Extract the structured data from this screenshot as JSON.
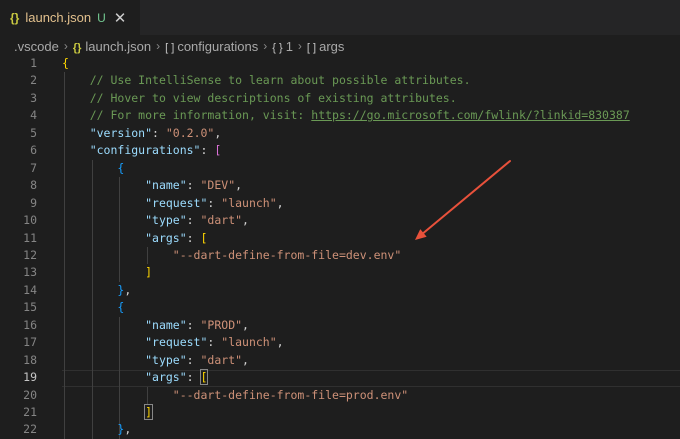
{
  "tab": {
    "icon": "json-braces-icon",
    "icon_glyph": "{}",
    "filename": "launch.json",
    "status": "U",
    "close_glyph": "✕"
  },
  "breadcrumb": {
    "items": [
      {
        "icon": "",
        "label": ".vscode"
      },
      {
        "icon": "{}",
        "label": "launch.json"
      },
      {
        "icon": "[ ]",
        "label": "configurations"
      },
      {
        "icon": "{ }",
        "label": "1"
      },
      {
        "icon": "[ ]",
        "label": "args"
      }
    ],
    "separator": "›"
  },
  "editor": {
    "active_line": 19,
    "lines": [
      {
        "n": "1",
        "tokens": [
          [
            "b1",
            "{"
          ]
        ]
      },
      {
        "n": "2",
        "tokens": [
          [
            "ws",
            "    "
          ],
          [
            "comment",
            "// Use IntelliSense to learn about possible attributes."
          ]
        ]
      },
      {
        "n": "3",
        "tokens": [
          [
            "ws",
            "    "
          ],
          [
            "comment",
            "// Hover to view descriptions of existing attributes."
          ]
        ]
      },
      {
        "n": "4",
        "tokens": [
          [
            "ws",
            "    "
          ],
          [
            "comment",
            "// For more information, visit: "
          ],
          [
            "link",
            "https://go.microsoft.com/fwlink/?linkid=830387"
          ]
        ]
      },
      {
        "n": "5",
        "tokens": [
          [
            "ws",
            "    "
          ],
          [
            "key",
            "\"version\""
          ],
          [
            "punct",
            ": "
          ],
          [
            "str",
            "\"0.2.0\""
          ],
          [
            "punct",
            ","
          ]
        ]
      },
      {
        "n": "6",
        "tokens": [
          [
            "ws",
            "    "
          ],
          [
            "key",
            "\"configurations\""
          ],
          [
            "punct",
            ": "
          ],
          [
            "b2",
            "["
          ]
        ]
      },
      {
        "n": "7",
        "tokens": [
          [
            "ws",
            "        "
          ],
          [
            "b3",
            "{"
          ]
        ]
      },
      {
        "n": "8",
        "tokens": [
          [
            "ws",
            "            "
          ],
          [
            "key",
            "\"name\""
          ],
          [
            "punct",
            ": "
          ],
          [
            "str",
            "\"DEV\""
          ],
          [
            "punct",
            ","
          ]
        ]
      },
      {
        "n": "9",
        "tokens": [
          [
            "ws",
            "            "
          ],
          [
            "key",
            "\"request\""
          ],
          [
            "punct",
            ": "
          ],
          [
            "str",
            "\"launch\""
          ],
          [
            "punct",
            ","
          ]
        ]
      },
      {
        "n": "10",
        "tokens": [
          [
            "ws",
            "            "
          ],
          [
            "key",
            "\"type\""
          ],
          [
            "punct",
            ": "
          ],
          [
            "str",
            "\"dart\""
          ],
          [
            "punct",
            ","
          ]
        ]
      },
      {
        "n": "11",
        "tokens": [
          [
            "ws",
            "            "
          ],
          [
            "key",
            "\"args\""
          ],
          [
            "punct",
            ": "
          ],
          [
            "b1",
            "["
          ]
        ]
      },
      {
        "n": "12",
        "tokens": [
          [
            "ws",
            "                "
          ],
          [
            "str",
            "\"--dart-define-from-file=dev.env\""
          ]
        ]
      },
      {
        "n": "13",
        "tokens": [
          [
            "ws",
            "            "
          ],
          [
            "b1",
            "]"
          ]
        ]
      },
      {
        "n": "14",
        "tokens": [
          [
            "ws",
            "        "
          ],
          [
            "b3",
            "}"
          ],
          [
            "punct",
            ","
          ]
        ]
      },
      {
        "n": "15",
        "tokens": [
          [
            "ws",
            "        "
          ],
          [
            "b3",
            "{"
          ]
        ]
      },
      {
        "n": "16",
        "tokens": [
          [
            "ws",
            "            "
          ],
          [
            "key",
            "\"name\""
          ],
          [
            "punct",
            ": "
          ],
          [
            "str",
            "\"PROD\""
          ],
          [
            "punct",
            ","
          ]
        ]
      },
      {
        "n": "17",
        "tokens": [
          [
            "ws",
            "            "
          ],
          [
            "key",
            "\"request\""
          ],
          [
            "punct",
            ": "
          ],
          [
            "str",
            "\"launch\""
          ],
          [
            "punct",
            ","
          ]
        ]
      },
      {
        "n": "18",
        "tokens": [
          [
            "ws",
            "            "
          ],
          [
            "key",
            "\"type\""
          ],
          [
            "punct",
            ": "
          ],
          [
            "str",
            "\"dart\""
          ],
          [
            "punct",
            ","
          ]
        ]
      },
      {
        "n": "19",
        "tokens": [
          [
            "ws",
            "            "
          ],
          [
            "key",
            "\"args\""
          ],
          [
            "punct",
            ": "
          ],
          [
            "b1m",
            "["
          ]
        ]
      },
      {
        "n": "20",
        "tokens": [
          [
            "ws",
            "                "
          ],
          [
            "str",
            "\"--dart-define-from-file=prod.env\""
          ]
        ]
      },
      {
        "n": "21",
        "tokens": [
          [
            "ws",
            "            "
          ],
          [
            "b1m",
            "]"
          ]
        ]
      },
      {
        "n": "22",
        "tokens": [
          [
            "ws",
            "        "
          ],
          [
            "b3",
            "}"
          ],
          [
            "punct",
            ","
          ]
        ]
      }
    ]
  },
  "annotation": {
    "type": "arrow",
    "color": "#e8513b",
    "points_to_line": 12
  },
  "colors": {
    "background": "#1e1e1e",
    "comment": "#6a9955",
    "property_key": "#9cdcfe",
    "string": "#ce9178",
    "bracket_level_1": "#ffd700",
    "bracket_level_2": "#da70d6",
    "bracket_level_3": "#179fff"
  }
}
